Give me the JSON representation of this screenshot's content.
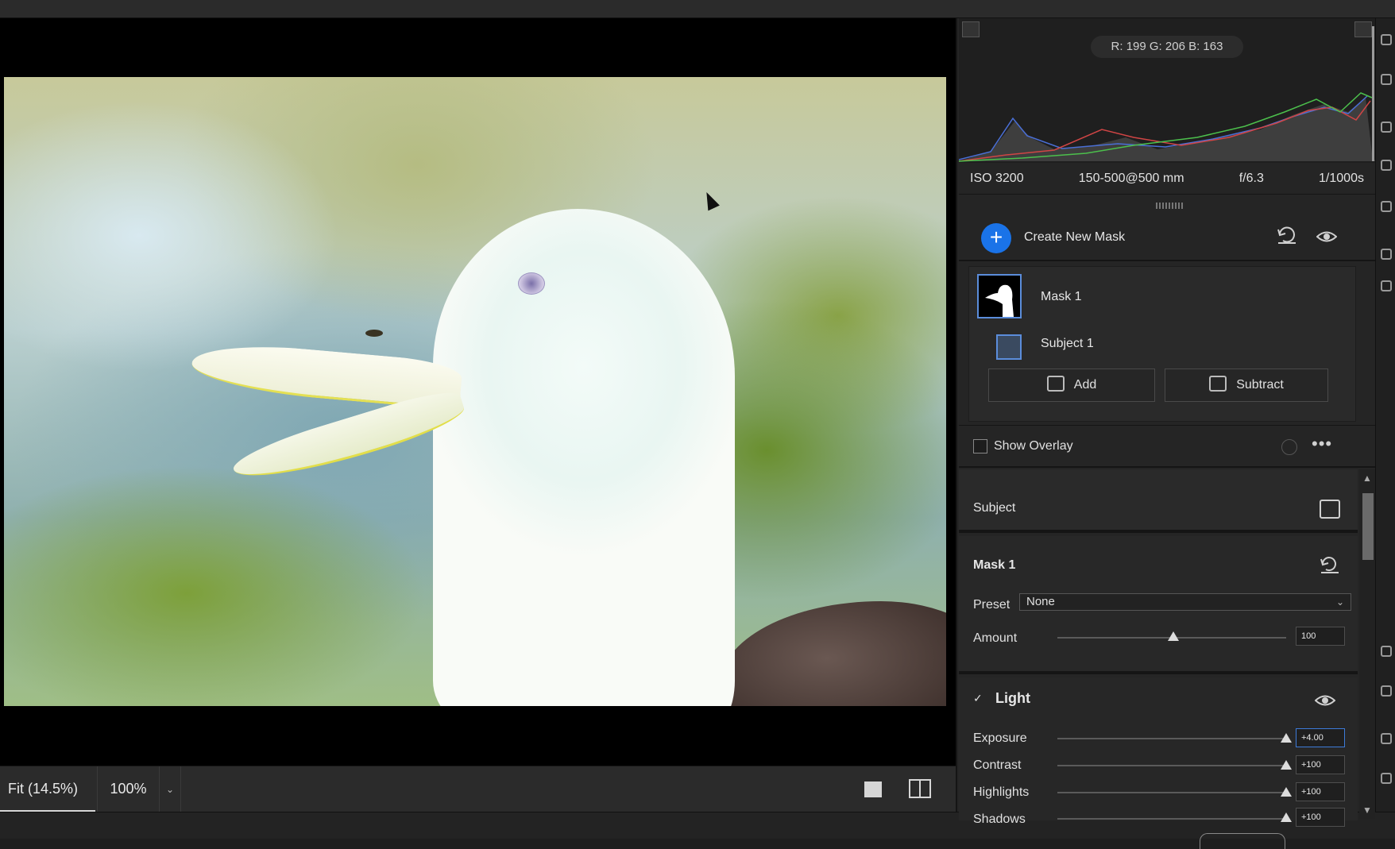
{
  "histogram": {
    "readout": "R: 199   G: 206   B: 163"
  },
  "exif": {
    "iso": "ISO 3200",
    "lens": "150-500@500 mm",
    "aperture": "f/6.3",
    "shutter": "1/1000s"
  },
  "masks": {
    "create_label": "Create New Mask",
    "items": [
      {
        "name": "Mask 1"
      },
      {
        "name": "Subject 1"
      }
    ],
    "add_label": "Add",
    "subtract_label": "Subtract",
    "show_overlay_label": "Show Overlay",
    "show_overlay_checked": false
  },
  "subject_section": {
    "label": "Subject"
  },
  "mask_settings": {
    "title": "Mask 1",
    "preset_label": "Preset",
    "preset_value": "None",
    "amount_label": "Amount",
    "amount_value": "100",
    "amount_level": 100
  },
  "light": {
    "title": "Light",
    "sliders": [
      {
        "label": "Exposure",
        "value": "+4.00",
        "level": 1.0
      },
      {
        "label": "Contrast",
        "value": "+100",
        "level": 1.0
      },
      {
        "label": "Highlights",
        "value": "+100",
        "level": 1.0
      },
      {
        "label": "Shadows",
        "value": "+100",
        "level": 1.0
      }
    ]
  },
  "bottom": {
    "zoom_fit": "Fit (14.5%)",
    "zoom_percent": "100%"
  },
  "colors": {
    "accent": "#1a73e8",
    "selection_border": "#5b8ddb"
  }
}
